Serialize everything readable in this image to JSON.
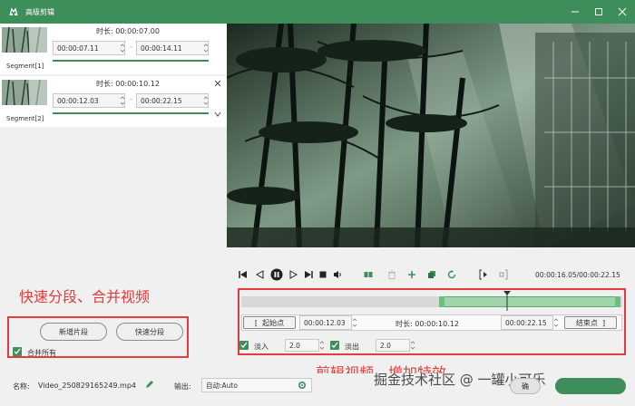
{
  "window": {
    "title": "高级剪辑"
  },
  "segments": [
    {
      "label": "Segment[1]",
      "duration_label": "时长:",
      "duration": "00:00:07.00",
      "start": "00:00:07.11",
      "end": "00:00:14.11"
    },
    {
      "label": "Segment[2]",
      "duration_label": "时长:",
      "duration": "00:00:10.12",
      "start": "00:00:12.03",
      "end": "00:00:22.15"
    }
  ],
  "left_panel": {
    "add_segment": "新增片段",
    "quick_split": "快速分段",
    "merge_all": "合并所有",
    "annotation": "快速分段、合并视频"
  },
  "player": {
    "time_display": "00:00:16.05/00:00:22.15"
  },
  "trim": {
    "start_btn": "起始点",
    "start_value": "00:00:12.03",
    "duration_label": "时长:",
    "duration_value": "00:00:10.12",
    "end_value": "00:00:22.15",
    "end_btn": "结束点",
    "fade_in_label": "淡入",
    "fade_in_value": "2.0",
    "fade_out_label": "淡出",
    "fade_out_value": "2.0",
    "annotation": "剪辑视频、增加特效"
  },
  "footer": {
    "name_label": "名称:",
    "name_value": "Video_250829165249.mp4",
    "output_label": "输出:",
    "output_value": "自动:Auto",
    "watermark": "掘金技术社区 @ 一罐小可乐",
    "button_partial": "确"
  },
  "colors": {
    "accent": "#3e8e5c",
    "annotation": "#e53b3b"
  }
}
